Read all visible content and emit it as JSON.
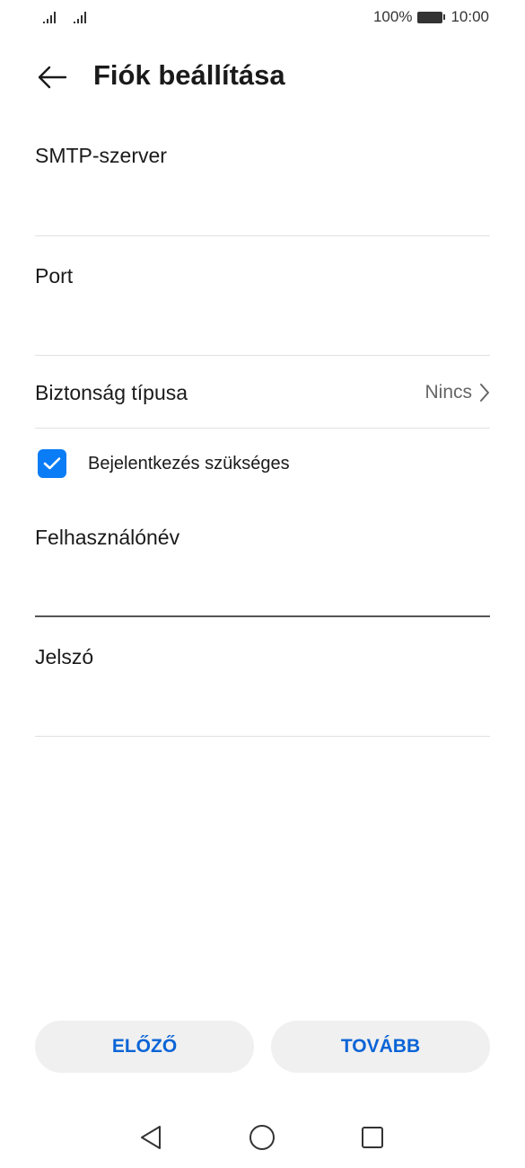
{
  "status_bar": {
    "battery_percent": "100%",
    "time": "10:00"
  },
  "header": {
    "back_icon": "arrow-left-icon",
    "title": "Fiók beállítása"
  },
  "form": {
    "smtp_server": {
      "label": "SMTP-szerver",
      "value": ""
    },
    "port": {
      "label": "Port",
      "value": ""
    },
    "security_type": {
      "label": "Biztonság típusa",
      "value": "Nincs"
    },
    "login_required": {
      "label": "Bejelentkezés szükséges",
      "checked": true
    },
    "username": {
      "label": "Felhasználónév",
      "value": ""
    },
    "password": {
      "label": "Jelszó",
      "value": ""
    }
  },
  "buttons": {
    "previous": "ELŐZŐ",
    "next": "TOVÁBB"
  },
  "nav_bar": {
    "back_icon": "triangle-back-icon",
    "home_icon": "circle-home-icon",
    "recent_icon": "square-recent-icon"
  },
  "colors": {
    "accent": "#0a7cf5",
    "button_text": "#0a64d6",
    "button_bg": "#f0f0f0",
    "divider": "#e0e0e0"
  }
}
